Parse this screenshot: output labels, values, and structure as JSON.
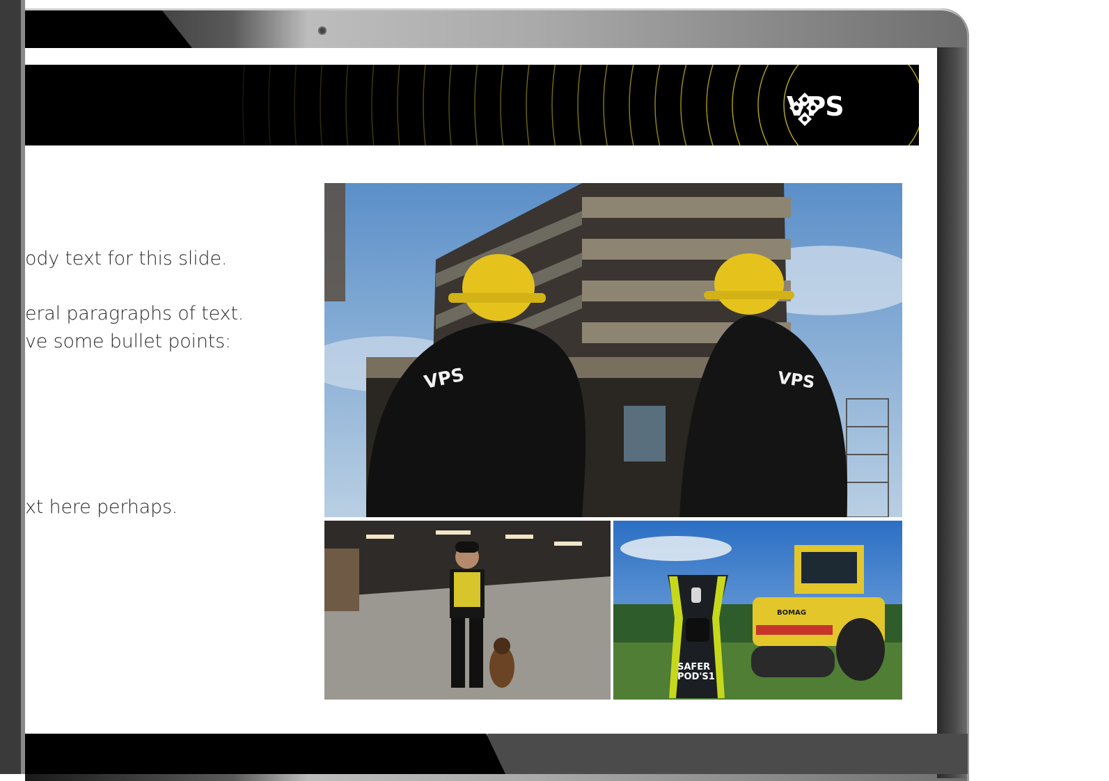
{
  "slide": {
    "logo_text": "VPS",
    "body_lines": [
      "ody text for this slide.",
      "eral paragraphs of text.",
      "ve some bullet points:",
      "xt here perhaps."
    ]
  },
  "photos": {
    "main": "workers-in-hard-hats-facing-building",
    "bottom_left": "security-guard-with-dog-in-warehouse",
    "bottom_right": "safer-pod-and-road-roller-on-grass",
    "pod_label_1": "SAFER",
    "pod_label_2": "POD'S1",
    "jacket_logo": "VPS",
    "roller_brand": "BOMAG"
  },
  "colors": {
    "accent_yellow": "#e3cf1e",
    "header_black": "#000000",
    "text": "#2b2b2b"
  }
}
